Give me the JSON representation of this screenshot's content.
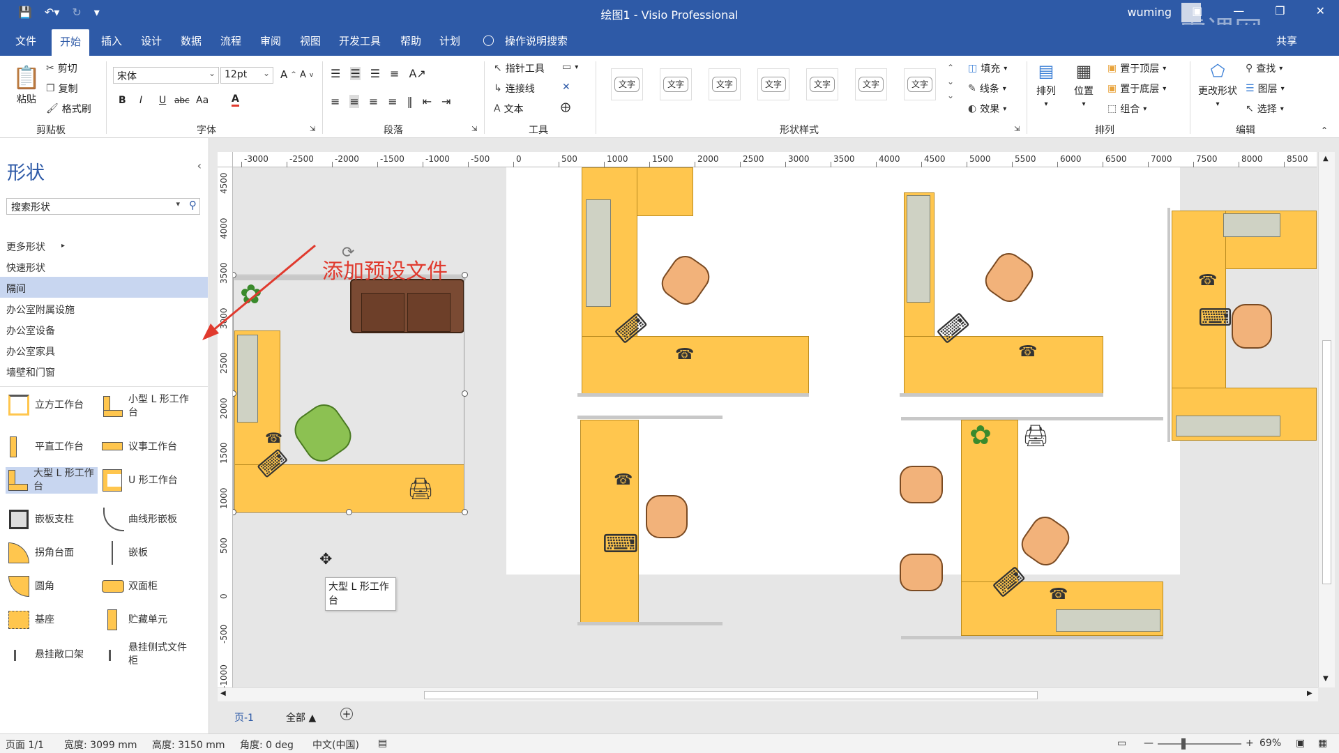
{
  "window": {
    "title": "绘图1 - Visio Professional",
    "user": "wuming",
    "watermark": "虎课网"
  },
  "quick_access": {
    "save_icon": "save-icon",
    "undo_icon": "undo-icon",
    "redo_icon": "redo-icon",
    "customize_icon": "customize-icon"
  },
  "tabs": [
    "文件",
    "开始",
    "插入",
    "设计",
    "数据",
    "流程",
    "审阅",
    "视图",
    "开发工具",
    "帮助",
    "计划"
  ],
  "active_tab": "开始",
  "tell_me": "操作说明搜索",
  "share": "共享",
  "ribbon": {
    "clipboard": {
      "paste": "粘贴",
      "cut": "剪切",
      "copy": "复制",
      "format_painter": "格式刷",
      "label": "剪贴板"
    },
    "font": {
      "family": "宋体",
      "size": "12pt",
      "label": "字体",
      "bold": "B",
      "italic": "I",
      "underline": "U",
      "strike": "abc",
      "case": "Aa",
      "color": "A",
      "grow": "A",
      "shrink": "A"
    },
    "paragraph": {
      "label": "段落"
    },
    "tools": {
      "pointer": "指针工具",
      "connector": "连接线",
      "text": "文本",
      "label": "工具"
    },
    "shape_styles": {
      "sample": "文字",
      "fill": "填充",
      "line": "线条",
      "effects": "效果",
      "label": "形状样式"
    },
    "arrange": {
      "arrange": "排列",
      "position": "位置",
      "bring_front": "置于顶层",
      "send_back": "置于底层",
      "group": "组合",
      "label": "排列"
    },
    "editing": {
      "change_shape": "更改形状",
      "find": "查找",
      "layers": "图层",
      "select": "选择",
      "label": "编辑"
    }
  },
  "shapes_pane": {
    "title": "形状",
    "search_placeholder": "搜索形状",
    "stencils": [
      "更多形状",
      "快速形状",
      "隔间",
      "办公室附属设施",
      "办公室设备",
      "办公室家具",
      "墙壁和门窗"
    ],
    "selected_stencil": "隔间",
    "shapes": [
      {
        "label": "立方工作台",
        "icon": "cube-workstation-icon"
      },
      {
        "label": "小型 L 形工作台",
        "icon": "small-l-workstation-icon"
      },
      {
        "label": "平直工作台",
        "icon": "straight-workstation-icon"
      },
      {
        "label": "议事工作台",
        "icon": "meeting-workstation-icon"
      },
      {
        "label": "大型 L 形工作台",
        "icon": "large-l-workstation-icon"
      },
      {
        "label": "U 形工作台",
        "icon": "u-workstation-icon"
      },
      {
        "label": "嵌板支柱",
        "icon": "panel-post-icon"
      },
      {
        "label": "曲线形嵌板",
        "icon": "curved-panel-icon"
      },
      {
        "label": "拐角台面",
        "icon": "corner-surface-icon"
      },
      {
        "label": "嵌板",
        "icon": "panel-icon"
      },
      {
        "label": "圆角",
        "icon": "round-corner-icon"
      },
      {
        "label": "双面柜",
        "icon": "double-cabinet-icon"
      },
      {
        "label": "基座",
        "icon": "pedestal-icon"
      },
      {
        "label": "贮藏单元",
        "icon": "storage-unit-icon"
      },
      {
        "label": "悬挂敞口架",
        "icon": "hanging-shelf-icon"
      },
      {
        "label": "悬挂侧式文件柜",
        "icon": "hanging-file-icon"
      }
    ],
    "selected_shape": "大型 L 形工作台"
  },
  "ruler": {
    "h_ticks": [
      "-3000",
      "-2500",
      "-2000",
      "-1500",
      "-1000",
      "-500",
      "0",
      "500",
      "1000",
      "1500",
      "2000",
      "2500",
      "3000",
      "3500",
      "4000",
      "4500",
      "5000",
      "5500",
      "6000",
      "6500",
      "7000",
      "7500",
      "8000",
      "8500"
    ],
    "v_ticks": [
      "4500",
      "4000",
      "3500",
      "3000",
      "2500",
      "2000",
      "1500",
      "1000",
      "500",
      "0",
      "-500",
      "-1000"
    ]
  },
  "annotation": "添加预设文件",
  "tooltip": "大型 L 形工作台",
  "page_tabs": {
    "page": "页-1",
    "all": "全部 ▲",
    "add": "+"
  },
  "status": {
    "page": "页面 1/1",
    "width": "宽度: 3099 mm",
    "height": "高度: 3150 mm",
    "angle": "角度: 0 deg",
    "language": "中文(中国)",
    "zoom": "69%"
  },
  "colors": {
    "accent": "#2e5aa7",
    "desk": "#ffc64e",
    "annotation": "#e03a2e",
    "selected": "#c8d6f0"
  }
}
